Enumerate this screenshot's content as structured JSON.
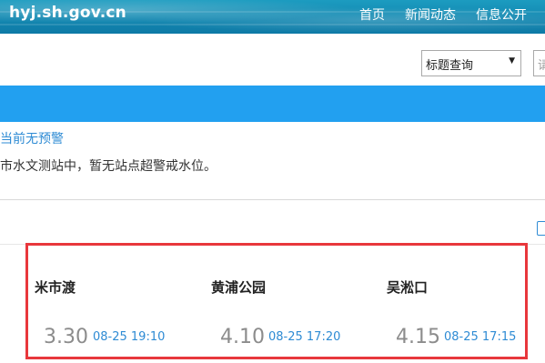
{
  "header": {
    "site_title": "hyj.sh.gov.cn",
    "nav": [
      "首页",
      "新闻动态",
      "信息公开"
    ]
  },
  "search": {
    "select_value": "标题查询",
    "input_placeholder": "请"
  },
  "warning": {
    "title": "当前无预警",
    "text": "市水文测站中，暂无站点超警戒水位。"
  },
  "stations": [
    {
      "name": "米市渡",
      "level": "3.30",
      "time": "08-25 19:10"
    },
    {
      "name": "黄浦公园",
      "level": "4.10",
      "time": "08-25 17:20"
    },
    {
      "name": "吴淞口",
      "level": "4.15",
      "time": "08-25 17:15"
    }
  ],
  "colors": {
    "banner": "#1389b2",
    "blue_bar": "#22a0f0",
    "link": "#2e8bd4",
    "highlight": "#e8373c"
  },
  "icons": {
    "caret": "caret-down-icon",
    "edit": "edit-icon"
  }
}
